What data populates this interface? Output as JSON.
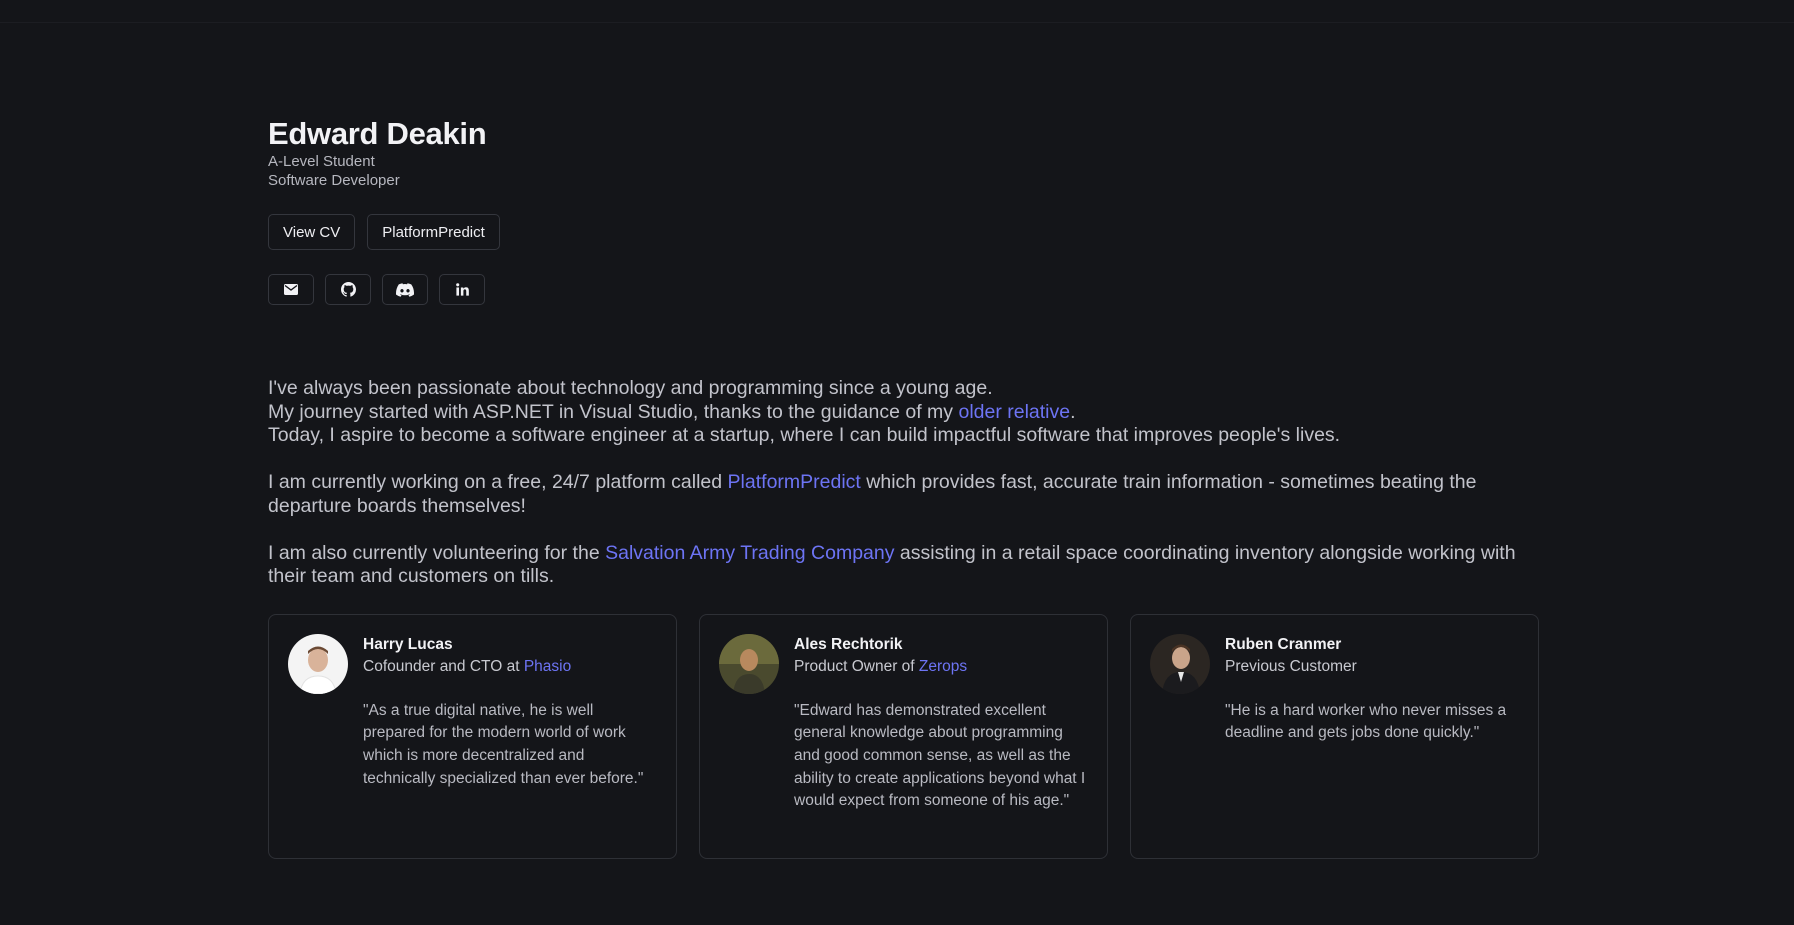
{
  "profile": {
    "name": "Edward Deakin",
    "subtitle_1": "A-Level Student",
    "subtitle_2": "Software Developer"
  },
  "buttons": {
    "view_cv": "View CV",
    "platform_predict": "PlatformPredict"
  },
  "social_icons": [
    "mail-icon",
    "github-icon",
    "discord-icon",
    "linkedin-icon"
  ],
  "bio": {
    "p1_line1": "I've always been passionate about technology and programming since a young age.",
    "p1_line2_pre": "My journey started with ASP.NET in Visual Studio, thanks to the guidance of my ",
    "p1_line2_link": "older relative",
    "p1_line2_post": ".",
    "p1_line3": "Today, I aspire to become a software engineer at a startup, where I can build impactful software that improves people's lives.",
    "p2_pre": "I am currently working on a free, 24/7 platform called ",
    "p2_link": "PlatformPredict",
    "p2_post": " which provides fast, accurate train information - sometimes beating the departure boards themselves!",
    "p3_pre": "I am also currently volunteering for the ",
    "p3_link": "Salvation Army Trading Company",
    "p3_post": " assisting in a retail space coordinating inventory alongside working with their team and customers on tills."
  },
  "testimonials": [
    {
      "name": "Harry Lucas",
      "role_pre": "Cofounder and CTO at ",
      "role_link": "Phasio",
      "quote": "\"As a true digital native, he is well prepared for the modern world of work which is more decentralized and technically specialized than ever before.\""
    },
    {
      "name": "Ales Rechtorik",
      "role_pre": "Product Owner of ",
      "role_link": "Zerops",
      "quote": "\"Edward has demonstrated excellent general knowledge about programming and good common sense, as well as the ability to create applications beyond what I would expect from someone of his age.\""
    },
    {
      "name": "Ruben Cranmer",
      "role_pre": "Previous Customer",
      "role_link": "",
      "quote": "\"He is a hard worker who never misses a deadline and gets jobs done quickly.\""
    }
  ],
  "colors": {
    "background": "#141519",
    "link": "#6d74f4",
    "border": "#34363d"
  }
}
